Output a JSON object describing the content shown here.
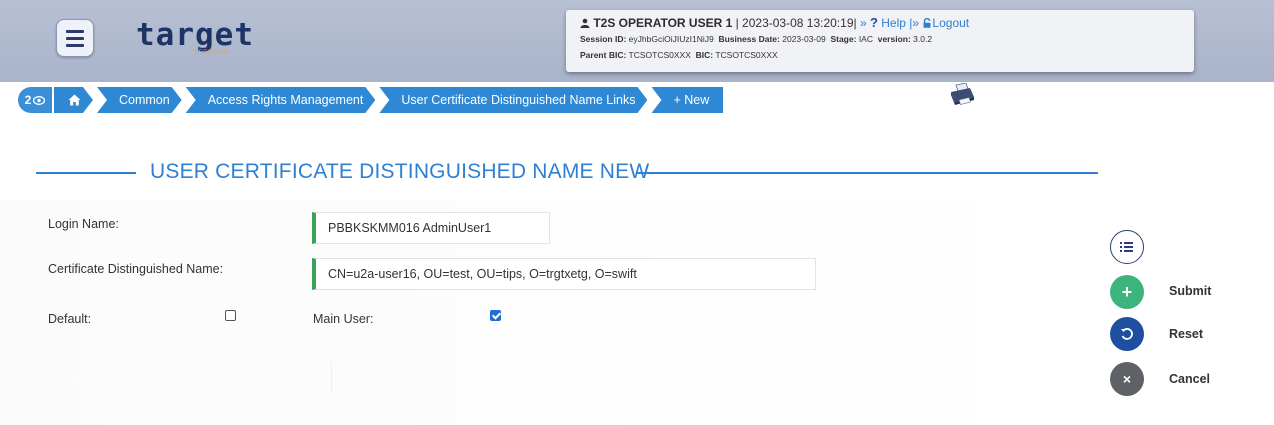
{
  "header": {
    "logo": "target",
    "logo_sub": "SERVICES",
    "user": "T2S OPERATOR USER 1",
    "datetime": "| 2023-03-08 13:20:19|",
    "help_sep": " » ",
    "help": "Help",
    "logout_sep": " |» ",
    "logout": "Logout",
    "session_label": "Session ID:",
    "session_id": "eyJhbGciOiJIUzI1NiJ9",
    "business_date_label": "Business Date:",
    "business_date": "2023-03-09",
    "stage_label": "Stage:",
    "stage": "IAC",
    "version_label": "version:",
    "version": "3.0.2",
    "parent_bic_label": "Parent BIC:",
    "parent_bic": "TCSOTCS0XXX",
    "bic_label": "BIC:",
    "bic": "TCSOTCS0XXX"
  },
  "breadcrumb": {
    "count": "2",
    "items": [
      "Common",
      "Access Rights Management",
      "User Certificate Distinguished Name Links",
      "+ New"
    ]
  },
  "page": {
    "title": "USER CERTIFICATE DISTINGUISHED NAME NEW"
  },
  "form": {
    "login_name_label": "Login Name:",
    "login_name_value": "PBBKSKMM016 AdminUser1",
    "cert_dn_label": "Certificate Distinguished Name:",
    "cert_dn_value": "CN=u2a-user16, OU=test, OU=tips, O=trgtxetg, O=swift",
    "default_label": "Default:",
    "default_checked": false,
    "main_user_label": "Main User:",
    "main_user_checked": true
  },
  "actions": {
    "submit": "Submit",
    "reset": "Reset",
    "cancel": "Cancel"
  },
  "colors": {
    "accent": "#2f7fd3",
    "breadcrumb": "#2e88d4",
    "submit": "#3db37d",
    "reset": "#1f4fa0",
    "cancel": "#5e6166",
    "field_marker": "#3aa35a"
  }
}
